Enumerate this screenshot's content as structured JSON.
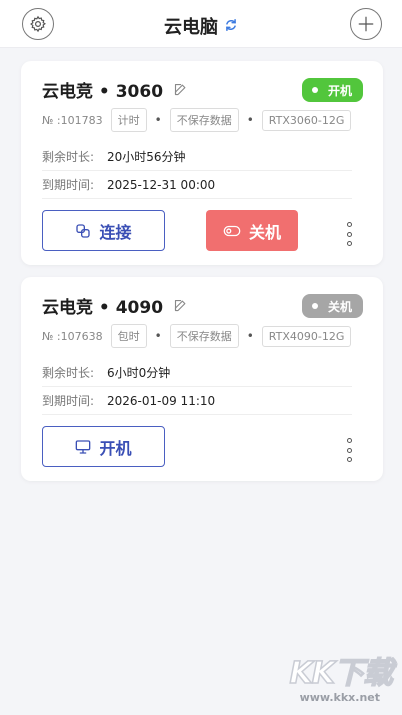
{
  "header": {
    "title": "云电脑",
    "settings_icon": "gear-icon",
    "refresh_icon": "refresh-icon",
    "add_icon": "plus-icon"
  },
  "colors": {
    "accent": "#3a4fb5",
    "on": "#52c63c",
    "off_badge": "#a6a6a6",
    "shutdown": "#f16f6f"
  },
  "machines": [
    {
      "name": "云电竞 • 3060",
      "status": "开机",
      "id": "№ :101783",
      "billing": "计时",
      "storage": "不保存数据",
      "gpu": "RTX3060-12G",
      "remaining_label": "剩余时长:",
      "remaining": "20小时56分钟",
      "expire_label": "到期时间:",
      "expire": "2025-12-31 00:00",
      "primary_action": "连接",
      "secondary_action": "关机"
    },
    {
      "name": "云电竞 • 4090",
      "status": "关机",
      "id": "№ :107638",
      "billing": "包时",
      "storage": "不保存数据",
      "gpu": "RTX4090-12G",
      "remaining_label": "剩余时长:",
      "remaining": "6小时0分钟",
      "expire_label": "到期时间:",
      "expire": "2026-01-09 11:10",
      "primary_action": "开机"
    }
  ],
  "watermark": {
    "logo": "KK下载",
    "url": "www.kkx.net"
  }
}
